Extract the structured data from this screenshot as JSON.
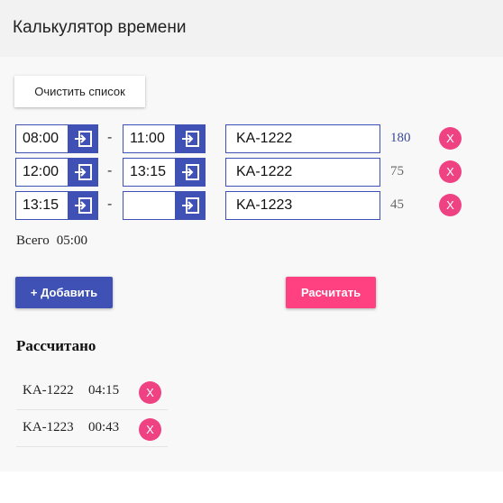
{
  "header": {
    "title": "Калькулятор времени"
  },
  "toolbar": {
    "clear_label": "Очистить список"
  },
  "entries": [
    {
      "start": "08:00",
      "end": "11:00",
      "code": "KA-1222",
      "minutes": "180"
    },
    {
      "start": "12:00",
      "end": "13:15",
      "code": "KA-1222",
      "minutes": "75"
    },
    {
      "start": "13:15",
      "end": "",
      "code": "KA-1223",
      "minutes": "45"
    }
  ],
  "separator": "-",
  "delete_label": "X",
  "total": {
    "label": "Всего",
    "value": "05:00"
  },
  "actions": {
    "add_label": "+ Добавить",
    "calculate_label": "Расчитать"
  },
  "results": {
    "title": "Рассчитано",
    "items": [
      {
        "code": "KA-1222",
        "time": "04:15"
      },
      {
        "code": "KA-1223",
        "time": "00:43"
      }
    ]
  },
  "colors": {
    "primary": "#3f51b5",
    "accent": "#ff4081",
    "delete": "#ee4282"
  },
  "icons": {
    "time_action": "login-arrow-icon"
  }
}
